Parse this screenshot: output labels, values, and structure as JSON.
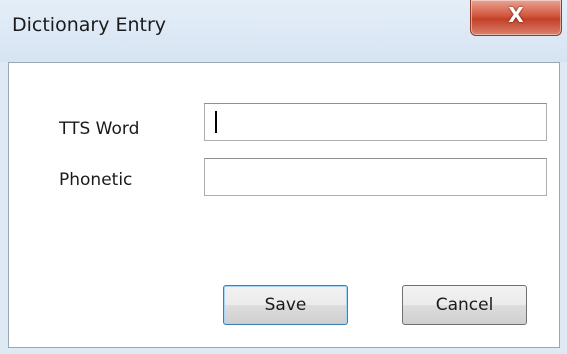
{
  "window": {
    "title": "Dictionary Entry",
    "close_glyph": "X"
  },
  "form": {
    "tts_word_label": "TTS Word",
    "tts_word_value": "",
    "phonetic_label": "Phonetic",
    "phonetic_value": ""
  },
  "buttons": {
    "save_label": "Save",
    "cancel_label": "Cancel"
  },
  "icons": {
    "close": "close-icon"
  }
}
